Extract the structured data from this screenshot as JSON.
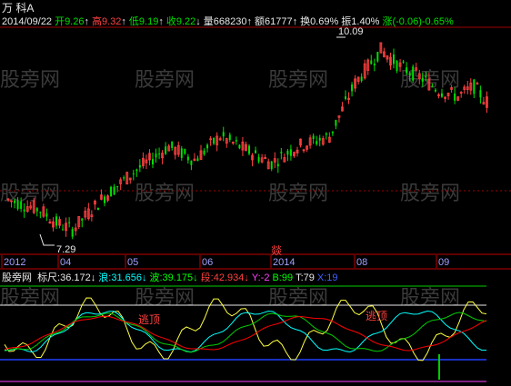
{
  "header": {
    "stock_name": "万 科A",
    "date": "2014/09/22",
    "open_label": "开",
    "open_value": "9.26",
    "high_label": "高",
    "high_value": "9.32",
    "low_label": "低",
    "low_value": "9.19",
    "close_label": "收",
    "close_value": "9.22",
    "volume_label": "量",
    "volume_value": "668230",
    "amount_label": "额",
    "amount_value": "61777",
    "turnover_label": "换",
    "turnover_value": "0.69%",
    "amplitude_label": "振",
    "amplitude_value": "1.40%",
    "change_label": "涨",
    "change_value": "(-0.06)",
    "change_pct": "-0.65%",
    "up_arrow": "↑",
    "down_arrow": "↓"
  },
  "price_chart": {
    "high_marker": "10.09",
    "low_marker": "7.29",
    "event_label": "燚",
    "ylim": [
      7.0,
      10.3
    ],
    "x_labels": [
      "2012",
      "04",
      "05",
      "06",
      "2014",
      "08",
      "09"
    ]
  },
  "indicator": {
    "name": "股旁网",
    "params": [
      {
        "label": "标尺",
        "value": "36.172",
        "arrow": "↓",
        "color": "#e8e8e8"
      },
      {
        "label": "浪",
        "value": "31.656",
        "arrow": "↓",
        "color": "#00ffff"
      },
      {
        "label": "波",
        "value": "39.175",
        "arrow": "↓",
        "color": "#00ff00"
      },
      {
        "label": "段",
        "value": "42.934",
        "arrow": "↓",
        "color": "#ff4040"
      },
      {
        "label": "Y",
        "value": "-2",
        "arrow": "",
        "color": "#ff40ff"
      },
      {
        "label": "B",
        "value": "99",
        "arrow": "",
        "color": "#00ff00"
      },
      {
        "label": "T",
        "value": "79",
        "arrow": "",
        "color": "#e8e8e8"
      },
      {
        "label": "X",
        "value": "19",
        "arrow": "",
        "color": "#4060ff"
      }
    ],
    "escape_label": "逃顶"
  },
  "watermark": "股旁网",
  "colors": {
    "up": "#ff4040",
    "down": "#00e000",
    "grid": "#a00000",
    "axis": "#c00000",
    "text": "#e8e8e8",
    "yellow": "#ffff40",
    "cyan": "#00ffff",
    "green_line": "#00cc00",
    "red_line": "#ff0000",
    "blue_line": "#2040ff",
    "magenta_line": "#ff40ff"
  }
}
